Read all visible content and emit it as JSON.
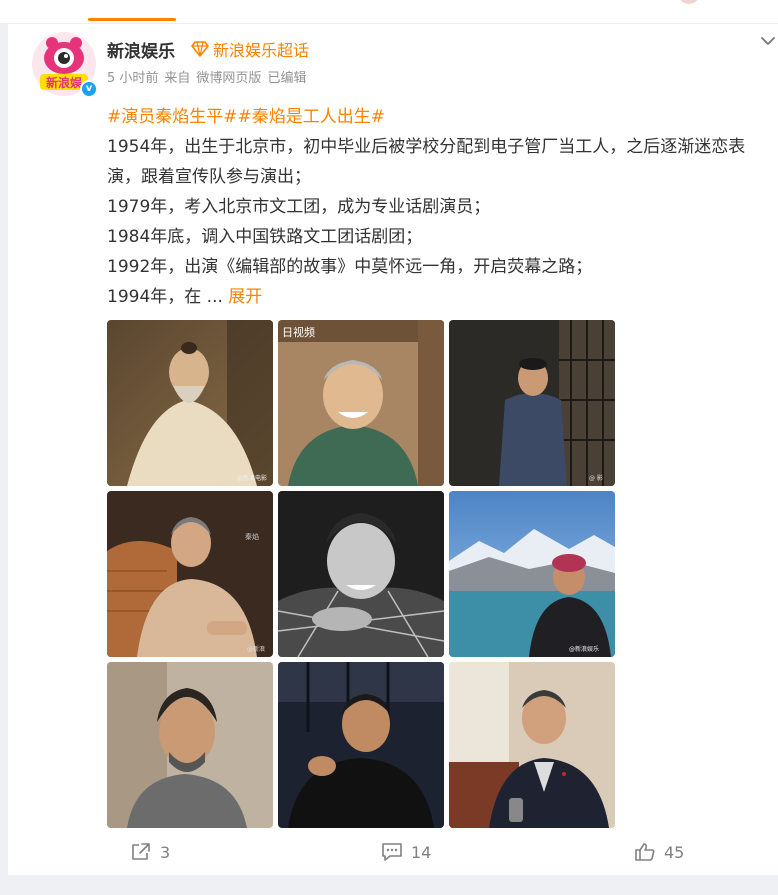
{
  "header": {
    "username": "新浪娱乐",
    "supertopic_label": "新浪娱乐超话",
    "time": "5 小时前",
    "source_prefix": "来自",
    "source": "微博网页版",
    "edited": "已编辑",
    "avatar_text": "新浪娱"
  },
  "post": {
    "topic1": "#演员秦焰生平#",
    "topic2": "#秦焰是工人出生#",
    "line1": "1954年，出生于北京市，初中毕业后被学校分配到电子管厂当工人，之后逐渐迷恋表演，跟着宣传队参与演出；",
    "line2": "1979年，考入北京市文工团，成为专业话剧演员；",
    "line3": "1984年底，调入中国铁路文工团话剧团；",
    "line4": "1992年，出演《编辑部的故事》中莫怀远一角，开启荧幕之路；",
    "line5": "1994年，在  ...",
    "expand": "展开"
  },
  "photos": {
    "p2_watermark": "日视频",
    "p1_credit": "@新浪电影",
    "p3_credit": "@ 影",
    "p5_caption": "秦焰",
    "p5_credit": "@新浪",
    "p4_credit": "@新浪",
    "p6_credit": "@新浪娱乐"
  },
  "actions": {
    "repost_count": "3",
    "comment_count": "14",
    "like_count": "45"
  },
  "colors": {
    "accent": "#ff8200",
    "meta": "#939393",
    "text": "#333333"
  }
}
